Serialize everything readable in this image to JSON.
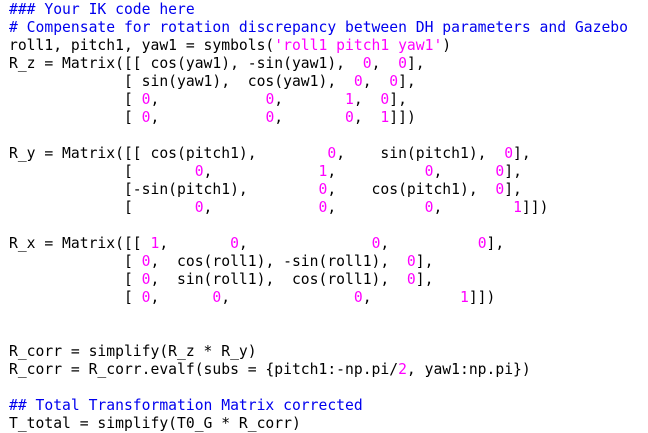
{
  "editor": {
    "colors": {
      "background": "#ffffff",
      "plain": "#000000",
      "comment": "#0000ee",
      "string": "#ff00ff",
      "number": "#ff00ff"
    },
    "lines": [
      [
        {
          "t": "comment",
          "v": "### Your IK code here"
        }
      ],
      [
        {
          "t": "comment",
          "v": "# Compensate for rotation discrepancy between DH parameters and Gazebo"
        }
      ],
      [
        {
          "t": "plain",
          "v": "roll1, pitch1, yaw1 = symbols("
        },
        {
          "t": "string",
          "v": "'roll1 pitch1 yaw1'"
        },
        {
          "t": "plain",
          "v": ")"
        }
      ],
      [
        {
          "t": "plain",
          "v": "R_z = Matrix([[ cos(yaw1), -sin(yaw1),  "
        },
        {
          "t": "number",
          "v": "0"
        },
        {
          "t": "plain",
          "v": ",  "
        },
        {
          "t": "number",
          "v": "0"
        },
        {
          "t": "plain",
          "v": "],"
        }
      ],
      [
        {
          "t": "plain",
          "v": "             [ sin(yaw1),  cos(yaw1),  "
        },
        {
          "t": "number",
          "v": "0"
        },
        {
          "t": "plain",
          "v": ",  "
        },
        {
          "t": "number",
          "v": "0"
        },
        {
          "t": "plain",
          "v": "],"
        }
      ],
      [
        {
          "t": "plain",
          "v": "             [ "
        },
        {
          "t": "number",
          "v": "0"
        },
        {
          "t": "plain",
          "v": ",            "
        },
        {
          "t": "number",
          "v": "0"
        },
        {
          "t": "plain",
          "v": ",       "
        },
        {
          "t": "number",
          "v": "1"
        },
        {
          "t": "plain",
          "v": ",  "
        },
        {
          "t": "number",
          "v": "0"
        },
        {
          "t": "plain",
          "v": "],"
        }
      ],
      [
        {
          "t": "plain",
          "v": "             [ "
        },
        {
          "t": "number",
          "v": "0"
        },
        {
          "t": "plain",
          "v": ",            "
        },
        {
          "t": "number",
          "v": "0"
        },
        {
          "t": "plain",
          "v": ",       "
        },
        {
          "t": "number",
          "v": "0"
        },
        {
          "t": "plain",
          "v": ",  "
        },
        {
          "t": "number",
          "v": "1"
        },
        {
          "t": "plain",
          "v": "]])"
        }
      ],
      [],
      [
        {
          "t": "plain",
          "v": "R_y = Matrix([[ cos(pitch1),        "
        },
        {
          "t": "number",
          "v": "0"
        },
        {
          "t": "plain",
          "v": ",    sin(pitch1),  "
        },
        {
          "t": "number",
          "v": "0"
        },
        {
          "t": "plain",
          "v": "],"
        }
      ],
      [
        {
          "t": "plain",
          "v": "             [       "
        },
        {
          "t": "number",
          "v": "0"
        },
        {
          "t": "plain",
          "v": ",            "
        },
        {
          "t": "number",
          "v": "1"
        },
        {
          "t": "plain",
          "v": ",          "
        },
        {
          "t": "number",
          "v": "0"
        },
        {
          "t": "plain",
          "v": ",      "
        },
        {
          "t": "number",
          "v": "0"
        },
        {
          "t": "plain",
          "v": "],"
        }
      ],
      [
        {
          "t": "plain",
          "v": "             [-sin(pitch1),        "
        },
        {
          "t": "number",
          "v": "0"
        },
        {
          "t": "plain",
          "v": ",    cos(pitch1),  "
        },
        {
          "t": "number",
          "v": "0"
        },
        {
          "t": "plain",
          "v": "],"
        }
      ],
      [
        {
          "t": "plain",
          "v": "             [       "
        },
        {
          "t": "number",
          "v": "0"
        },
        {
          "t": "plain",
          "v": ",            "
        },
        {
          "t": "number",
          "v": "0"
        },
        {
          "t": "plain",
          "v": ",          "
        },
        {
          "t": "number",
          "v": "0"
        },
        {
          "t": "plain",
          "v": ",        "
        },
        {
          "t": "number",
          "v": "1"
        },
        {
          "t": "plain",
          "v": "]])"
        }
      ],
      [],
      [
        {
          "t": "plain",
          "v": "R_x = Matrix([[ "
        },
        {
          "t": "number",
          "v": "1"
        },
        {
          "t": "plain",
          "v": ",       "
        },
        {
          "t": "number",
          "v": "0"
        },
        {
          "t": "plain",
          "v": ",              "
        },
        {
          "t": "number",
          "v": "0"
        },
        {
          "t": "plain",
          "v": ",          "
        },
        {
          "t": "number",
          "v": "0"
        },
        {
          "t": "plain",
          "v": "],"
        }
      ],
      [
        {
          "t": "plain",
          "v": "             [ "
        },
        {
          "t": "number",
          "v": "0"
        },
        {
          "t": "plain",
          "v": ",  cos(roll1), -sin(roll1),  "
        },
        {
          "t": "number",
          "v": "0"
        },
        {
          "t": "plain",
          "v": "],"
        }
      ],
      [
        {
          "t": "plain",
          "v": "             [ "
        },
        {
          "t": "number",
          "v": "0"
        },
        {
          "t": "plain",
          "v": ",  sin(roll1),  cos(roll1),  "
        },
        {
          "t": "number",
          "v": "0"
        },
        {
          "t": "plain",
          "v": "],"
        }
      ],
      [
        {
          "t": "plain",
          "v": "             [ "
        },
        {
          "t": "number",
          "v": "0"
        },
        {
          "t": "plain",
          "v": ",      "
        },
        {
          "t": "number",
          "v": "0"
        },
        {
          "t": "plain",
          "v": ",              "
        },
        {
          "t": "number",
          "v": "0"
        },
        {
          "t": "plain",
          "v": ",          "
        },
        {
          "t": "number",
          "v": "1"
        },
        {
          "t": "plain",
          "v": "]])"
        }
      ],
      [],
      [],
      [
        {
          "t": "plain",
          "v": "R_corr = simplify(R_z * R_y)"
        }
      ],
      [
        {
          "t": "plain",
          "v": "R_corr = R_corr.evalf(subs = {pitch1:-np.pi/"
        },
        {
          "t": "number",
          "v": "2"
        },
        {
          "t": "plain",
          "v": ", yaw1:np.pi})"
        }
      ],
      [],
      [
        {
          "t": "comment",
          "v": "## Total Transformation Matrix corrected"
        }
      ],
      [
        {
          "t": "plain",
          "v": "T_total = simplify(T0_G * R_corr)"
        }
      ]
    ]
  }
}
